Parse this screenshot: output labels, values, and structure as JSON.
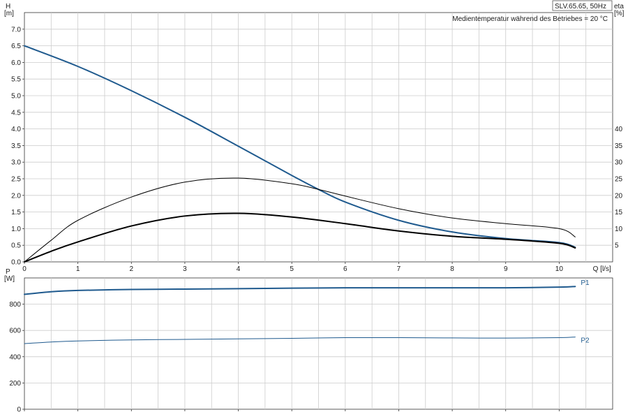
{
  "model_label": "SLV.65.65, 50Hz",
  "temperature_note": "Medientemperatur während des Betriebes = 20 °C",
  "colors": {
    "pump_curve": "#1f5a8e",
    "efficiency": "#000000",
    "grid": "#cccccc",
    "axis": "#333333"
  },
  "chart_data": [
    {
      "type": "line",
      "axes": {
        "x": {
          "label": "Q [l/s]",
          "range": [
            0,
            11.0
          ],
          "ticks": [
            0,
            1,
            2,
            3,
            4,
            5,
            6,
            7,
            8,
            9,
            10
          ]
        },
        "y_left": {
          "label_top": "H",
          "label_unit": "[m]",
          "range": [
            0,
            7.5
          ],
          "ticks": [
            0.0,
            0.5,
            1.0,
            1.5,
            2.0,
            2.5,
            3.0,
            3.5,
            4.0,
            4.5,
            5.0,
            5.5,
            6.0,
            6.5,
            7.0
          ]
        },
        "y_right": {
          "label_top": "eta",
          "label_unit": "[%]",
          "range": [
            0,
            75
          ],
          "ticks": [
            5,
            10,
            15,
            20,
            25,
            30,
            35,
            40
          ]
        }
      },
      "grid": true,
      "series": [
        {
          "axis": "left",
          "color": "#1f5a8e",
          "width": 2,
          "x": [
            0,
            1,
            2,
            3,
            4,
            5,
            5.5,
            6,
            7,
            8,
            9,
            10,
            10.3
          ],
          "y": [
            6.5,
            5.88,
            5.15,
            4.35,
            3.48,
            2.6,
            2.18,
            1.8,
            1.25,
            0.9,
            0.7,
            0.58,
            0.44
          ]
        },
        {
          "axis": "right",
          "color": "#000000",
          "width": 1,
          "x": [
            0,
            0.5,
            1,
            2,
            3,
            4,
            5,
            5.5,
            6,
            7,
            8,
            9,
            10,
            10.3
          ],
          "y": [
            0,
            6.5,
            12.5,
            19.5,
            24,
            25.2,
            23.5,
            21.8,
            19.8,
            16,
            13.2,
            11.5,
            10,
            7.5
          ]
        },
        {
          "axis": "left",
          "color": "#000000",
          "width": 2,
          "x": [
            0,
            0.5,
            1,
            2,
            3,
            4,
            5,
            6,
            7,
            8,
            9,
            10,
            10.3
          ],
          "y": [
            0,
            0.32,
            0.6,
            1.08,
            1.38,
            1.46,
            1.35,
            1.15,
            0.93,
            0.77,
            0.68,
            0.56,
            0.42
          ]
        }
      ]
    },
    {
      "type": "line",
      "axes": {
        "x": {
          "range": [
            0,
            11.0
          ],
          "ticks": [
            0,
            1,
            2,
            3,
            4,
            5,
            6,
            7,
            8,
            9,
            10
          ]
        },
        "y_left": {
          "label_top": "P",
          "label_unit": "[W]",
          "range": [
            0,
            1000
          ],
          "ticks": [
            0,
            200,
            400,
            600,
            800
          ]
        }
      },
      "grid": true,
      "series": [
        {
          "name": "P1",
          "color": "#1f5a8e",
          "width": 2,
          "x": [
            0,
            0.5,
            1,
            2,
            3,
            4,
            5,
            6,
            7,
            8,
            9,
            10,
            10.3
          ],
          "y": [
            875,
            895,
            905,
            912,
            915,
            918,
            922,
            925,
            925,
            925,
            925,
            930,
            935
          ]
        },
        {
          "name": "P2",
          "color": "#1f5a8e",
          "width": 1,
          "x": [
            0,
            0.5,
            1,
            2,
            3,
            4,
            5,
            6,
            7,
            8,
            9,
            10,
            10.3
          ],
          "y": [
            500,
            512,
            520,
            528,
            532,
            536,
            540,
            545,
            545,
            543,
            542,
            545,
            550
          ]
        }
      ]
    }
  ]
}
